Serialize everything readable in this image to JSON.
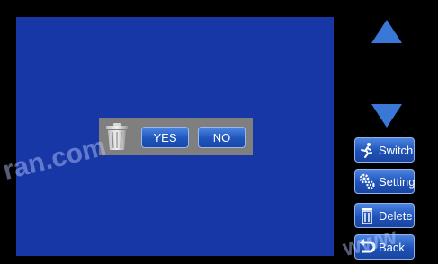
{
  "nav": {
    "up_icon": "arrow-up-icon",
    "down_icon": "arrow-down-icon"
  },
  "sidebar": {
    "buttons": [
      {
        "label": "Switch",
        "icon": "running-person-icon"
      },
      {
        "label": "Setting",
        "icon": "gears-icon"
      },
      {
        "label": "Delete",
        "icon": "trash-icon"
      },
      {
        "label": "Back",
        "icon": "back-arrow-icon"
      }
    ]
  },
  "dialog": {
    "icon": "trash-can-icon",
    "yes_label": "YES",
    "no_label": "NO"
  },
  "watermark": {
    "left_text": "ran.com",
    "right_text": "www"
  },
  "colors": {
    "screen": "#1737a6",
    "background": "#000000",
    "dialog": "#7f7f7f",
    "button": "#1e52b8",
    "arrow": "#3a78d8"
  }
}
